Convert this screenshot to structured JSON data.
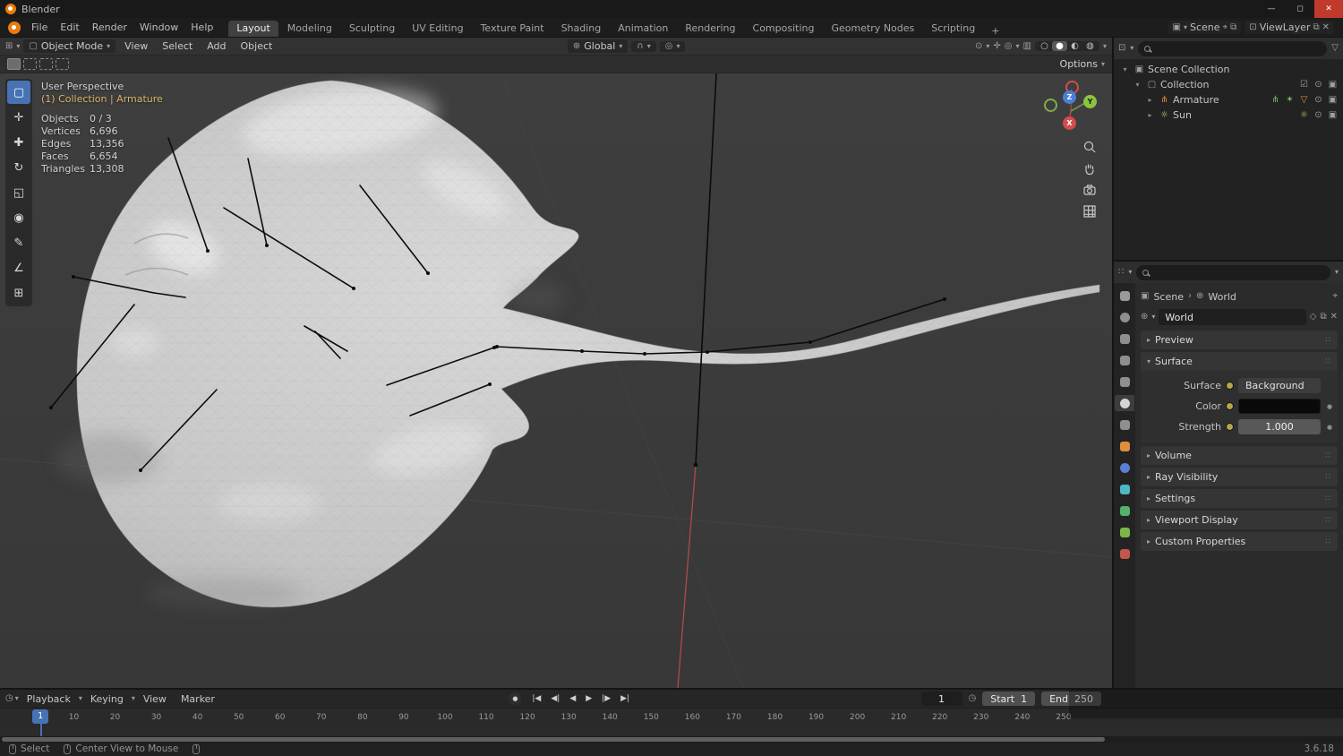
{
  "window": {
    "title": "Blender",
    "version": "3.6.18"
  },
  "icons": {
    "caret": "▾",
    "collapsed": "▸",
    "expanded": "▾",
    "globe": "⊕",
    "magnet": "∩",
    "prop_edit": "◎",
    "grid_editor": "⊞",
    "mode_icon": "▢",
    "clock": "◷",
    "funnel": "▽",
    "eye": "⊙",
    "camera": "▣",
    "screen": "⊡",
    "checkbox": "☑",
    "armature": "⋔",
    "sun": "☼",
    "collection": "▢",
    "scene_collection": "▣",
    "world_mini": "⊕",
    "scene_mini": "▣",
    "pin": "⌖",
    "copy": "⧉",
    "x": "✕",
    "shield": "◇",
    "record": "●",
    "grip": "∷",
    "min": "—",
    "max": "◻",
    "visibility": "⊙",
    "gizmos": "✛",
    "overlays": "◎",
    "xray": "▥",
    "bone_links": "⋔",
    "action": "✶",
    "triangle": "▽"
  },
  "topbar": {
    "menus": [
      {
        "label": "File"
      },
      {
        "label": "Edit"
      },
      {
        "label": "Render"
      },
      {
        "label": "Window"
      },
      {
        "label": "Help"
      }
    ],
    "workspaces": [
      {
        "label": "Layout"
      },
      {
        "label": "Modeling"
      },
      {
        "label": "Sculpting"
      },
      {
        "label": "UV Editing"
      },
      {
        "label": "Texture Paint"
      },
      {
        "label": "Shading"
      },
      {
        "label": "Animation"
      },
      {
        "label": "Rendering"
      },
      {
        "label": "Compositing"
      },
      {
        "label": "Geometry Nodes"
      },
      {
        "label": "Scripting"
      }
    ],
    "add_workspace": "+",
    "scene_label": "Scene",
    "viewlayer_label": "ViewLayer"
  },
  "viewport": {
    "header": {
      "mode": "Object Mode",
      "menus": [
        {
          "label": "View"
        },
        {
          "label": "Select"
        },
        {
          "label": "Add"
        },
        {
          "label": "Object"
        }
      ],
      "orientation": "Global",
      "options": "Options",
      "shading": [
        "○",
        "●",
        "◐",
        "◍"
      ]
    },
    "overlay": {
      "perspective": "User Perspective",
      "context": "(1) Collection | Armature",
      "stats": [
        {
          "label": "Objects",
          "value": "0 / 3"
        },
        {
          "label": "Vertices",
          "value": "6,696"
        },
        {
          "label": "Edges",
          "value": "13,356"
        },
        {
          "label": "Faces",
          "value": "6,654"
        },
        {
          "label": "Triangles",
          "value": "13,308"
        }
      ]
    },
    "gizmo": {
      "x": "X",
      "y": "Y",
      "z": "Z"
    },
    "tools": [
      {
        "name": "select-box",
        "glyph": "▢"
      },
      {
        "name": "cursor",
        "glyph": "✛"
      },
      {
        "name": "move",
        "glyph": "✚"
      },
      {
        "name": "rotate",
        "glyph": "↻"
      },
      {
        "name": "scale",
        "glyph": "◱"
      },
      {
        "name": "transform",
        "glyph": "◉"
      },
      {
        "name": "annotate",
        "glyph": "✎"
      },
      {
        "name": "measure",
        "glyph": "∠"
      },
      {
        "name": "add-cube",
        "glyph": "⊞"
      }
    ]
  },
  "outliner": {
    "rows": [
      {
        "label": "Scene Collection"
      },
      {
        "label": "Collection"
      },
      {
        "label": "Armature"
      },
      {
        "label": "Sun"
      }
    ]
  },
  "properties": {
    "breadcrumb": {
      "scene": "Scene",
      "sep": "›",
      "target": "World"
    },
    "datablock": "World",
    "tabs": [
      {
        "name": "tool",
        "color": "#9a9a9a"
      },
      {
        "name": "render",
        "color": "#8f8f8f"
      },
      {
        "name": "output",
        "color": "#8f8f8f"
      },
      {
        "name": "view-layer",
        "color": "#8f8f8f"
      },
      {
        "name": "scene",
        "color": "#8f8f8f"
      },
      {
        "name": "world",
        "color": "#d4d4d4"
      },
      {
        "name": "collection",
        "color": "#8f8f8f"
      },
      {
        "name": "object",
        "color": "#e08d3c"
      },
      {
        "name": "physics",
        "color": "#5a7fd0"
      },
      {
        "name": "constraints",
        "color": "#4fb8c4"
      },
      {
        "name": "object-data",
        "color": "#54b06a"
      },
      {
        "name": "modifiers",
        "color": "#7ab648"
      },
      {
        "name": "texture",
        "color": "#c4564a"
      }
    ],
    "panels": [
      {
        "label": "Preview"
      },
      {
        "label": "Surface"
      },
      {
        "label": "Volume"
      },
      {
        "label": "Ray Visibility"
      },
      {
        "label": "Settings"
      },
      {
        "label": "Viewport Display"
      },
      {
        "label": "Custom Properties"
      }
    ],
    "surface": {
      "rows": [
        {
          "label": "Surface",
          "value": "Background"
        },
        {
          "label": "Color",
          "value": "#0a0a0a"
        },
        {
          "label": "Strength",
          "value": "1.000"
        }
      ]
    }
  },
  "timeline": {
    "menus": [
      {
        "label": "Playback",
        "caret": true
      },
      {
        "label": "Keying",
        "caret": true
      },
      {
        "label": "View",
        "caret": false
      },
      {
        "label": "Marker",
        "caret": false
      }
    ],
    "transport": [
      "|◀",
      "◀|",
      "◀",
      "▶",
      "|▶",
      "▶|"
    ],
    "current_frame": "1",
    "start_label": "Start",
    "start_value": "1",
    "end_label": "End",
    "end_value": "250",
    "ticks": [
      10,
      20,
      30,
      40,
      50,
      60,
      70,
      80,
      90,
      100,
      110,
      120,
      130,
      140,
      150,
      160,
      170,
      180,
      190,
      200,
      210,
      220,
      230,
      240,
      250
    ]
  },
  "statusbar": {
    "hints": [
      {
        "label": "Select"
      },
      {
        "label": "Center View to Mouse"
      }
    ],
    "version": "3.6.18"
  }
}
